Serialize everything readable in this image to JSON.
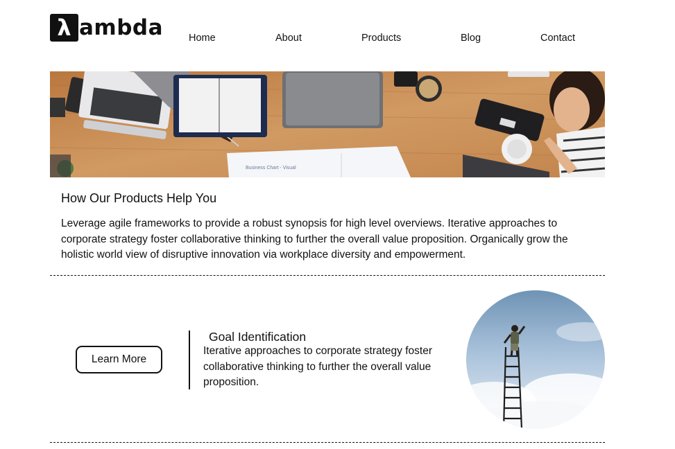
{
  "brand": {
    "logo_glyph": "λ",
    "logo_text": "ambda"
  },
  "nav": {
    "items": [
      {
        "label": "Home"
      },
      {
        "label": "About"
      },
      {
        "label": "Products"
      },
      {
        "label": "Blog"
      },
      {
        "label": "Contact"
      }
    ]
  },
  "hero": {
    "chart_paper_label": "Business Chart - Visual",
    "description": ""
  },
  "intro": {
    "title": "How Our Products Help You",
    "text": "Leverage agile frameworks to provide a robust synopsis for high level overviews. Iterative approaches to corporate strategy foster collaborative thinking to further the overall value proposition. Organically grow the holistic world view of disruptive innovation via workplace diversity and empowerment."
  },
  "feature": {
    "button_label": "Learn More",
    "title": "Goal Identification",
    "text": "Iterative approaches to corporate strategy foster collaborative thinking to further the overall value proposition."
  },
  "colors": {
    "text": "#111111",
    "background": "#ffffff",
    "desk_wood": "#c98f55",
    "sky": "#9dbad6"
  }
}
